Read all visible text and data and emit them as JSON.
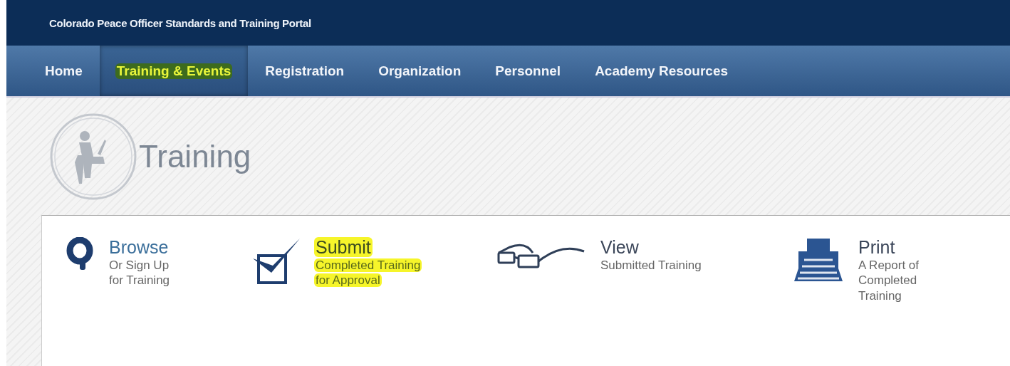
{
  "header": {
    "title": "Colorado Peace Officer Standards and Training Portal"
  },
  "nav": [
    {
      "label": "Home",
      "selected": false,
      "highlighted": false
    },
    {
      "label": "Training & Events",
      "selected": true,
      "highlighted": true
    },
    {
      "label": "Registration",
      "selected": false,
      "highlighted": false
    },
    {
      "label": "Organization",
      "selected": false,
      "highlighted": false
    },
    {
      "label": "Personnel",
      "selected": false,
      "highlighted": false
    },
    {
      "label": "Academy Resources",
      "selected": false,
      "highlighted": false
    }
  ],
  "page": {
    "title": "Training"
  },
  "actions": [
    {
      "kind": "browse",
      "title": "Browse",
      "lines": [
        "Or Sign Up",
        "for Training"
      ],
      "highlighted": false
    },
    {
      "kind": "submit",
      "title": "Submit",
      "lines": [
        "Completed Training",
        "for Approval"
      ],
      "highlighted": true
    },
    {
      "kind": "view",
      "title": "View",
      "lines": [
        "Submitted Training"
      ],
      "highlighted": false
    },
    {
      "kind": "print",
      "title": "Print",
      "lines": [
        "A Report of",
        "Completed",
        "Training"
      ],
      "highlighted": false
    }
  ]
}
